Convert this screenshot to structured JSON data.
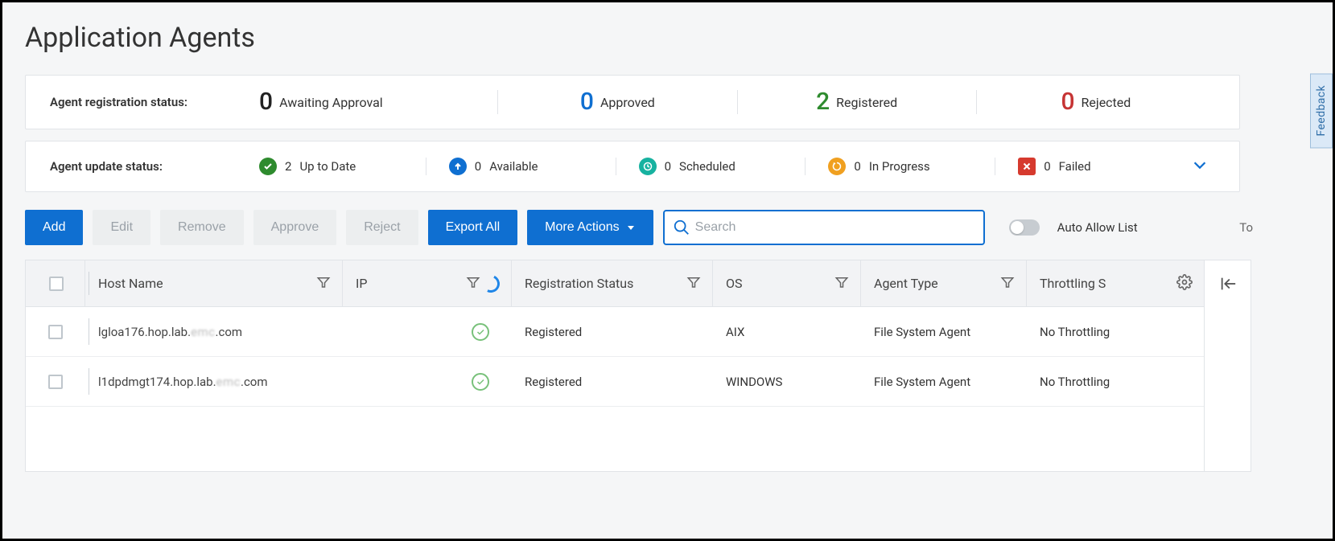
{
  "page": {
    "title": "Application Agents"
  },
  "feedback": {
    "label": "Feedback"
  },
  "registration_status": {
    "label": "Agent registration status:",
    "awaiting": {
      "count": "0",
      "label": "Awaiting Approval"
    },
    "approved": {
      "count": "0",
      "label": "Approved"
    },
    "registered": {
      "count": "2",
      "label": "Registered"
    },
    "rejected": {
      "count": "0",
      "label": "Rejected"
    }
  },
  "update_status": {
    "label": "Agent update status:",
    "uptodate": {
      "count": "2",
      "label": "Up to Date"
    },
    "available": {
      "count": "0",
      "label": "Available"
    },
    "scheduled": {
      "count": "0",
      "label": "Scheduled"
    },
    "inprogress": {
      "count": "0",
      "label": "In Progress"
    },
    "failed": {
      "count": "0",
      "label": "Failed"
    }
  },
  "toolbar": {
    "add": "Add",
    "edit": "Edit",
    "remove": "Remove",
    "approve": "Approve",
    "reject": "Reject",
    "export_all": "Export All",
    "more_actions": "More Actions",
    "search_placeholder": "Search",
    "auto_allow_list": "Auto Allow List",
    "overflow_hint": "To"
  },
  "table": {
    "columns": {
      "host": "Host Name",
      "ip": "IP",
      "reg": "Registration Status",
      "os": "OS",
      "agent": "Agent Type",
      "throt": "Throttling S"
    },
    "rows": [
      {
        "host_prefix": "lgloa176.hop.lab.",
        "host_obscured": "emc",
        "host_suffix": ".com",
        "ip_ok": true,
        "reg": "Registered",
        "os": "AIX",
        "agent": "File System Agent",
        "throt": "No Throttling"
      },
      {
        "host_prefix": "l1dpdmgt174.hop.lab.",
        "host_obscured": "emc",
        "host_suffix": ".com",
        "ip_ok": true,
        "reg": "Registered",
        "os": "WINDOWS",
        "agent": "File System Agent",
        "throt": "No Throttling"
      }
    ]
  }
}
